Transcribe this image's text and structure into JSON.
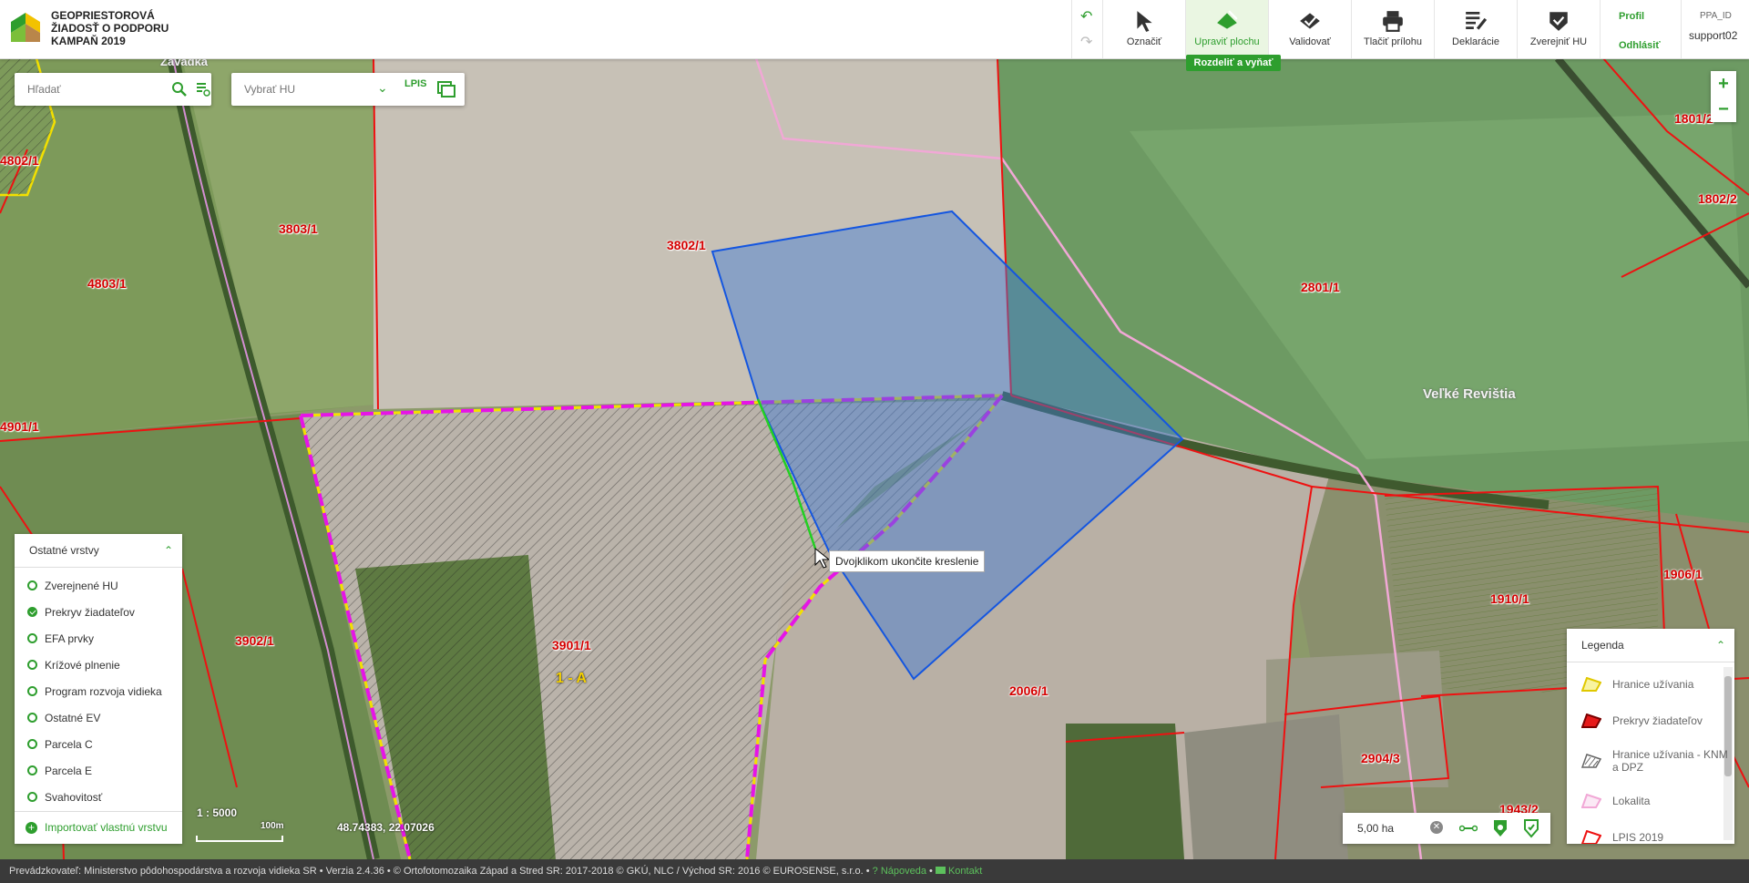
{
  "app": {
    "title_lines": [
      "GEOPRIESTOROVÁ",
      "ŽIADOSŤ O PODPORU",
      "KAMPAŇ 2019"
    ]
  },
  "toolbar": {
    "tools": [
      {
        "label": "Označiť",
        "icon": "cursor-icon"
      },
      {
        "label": "Upraviť plochu",
        "icon": "edit-area-icon",
        "active": true
      },
      {
        "label": "Validovať",
        "icon": "validate-icon"
      },
      {
        "label": "Tlačiť prílohu",
        "icon": "print-icon"
      },
      {
        "label": "Deklarácie",
        "icon": "declarations-icon"
      },
      {
        "label": "Zverejniť HU",
        "icon": "publish-icon"
      }
    ],
    "active_subaction": "Rozdeliť a vyňať",
    "profile_label": "Profil",
    "logout_label": "Odhlásiť",
    "ppa_label": "PPA_ID",
    "user": "support02"
  },
  "search": {
    "placeholder": "Hľadať",
    "hu_placeholder": "Vybrať HU",
    "lpis_label": "LPIS"
  },
  "layers_panel": {
    "title": "Ostatné vrstvy",
    "items": [
      {
        "label": "Zverejnené HU",
        "checked": false
      },
      {
        "label": "Prekryv žiadateľov",
        "checked": true
      },
      {
        "label": "EFA prvky",
        "checked": false
      },
      {
        "label": "Krížové plnenie",
        "checked": false
      },
      {
        "label": "Program rozvoja vidieka",
        "checked": false
      },
      {
        "label": "Ostatné EV",
        "checked": false
      },
      {
        "label": "Parcela C",
        "checked": false
      },
      {
        "label": "Parcela E",
        "checked": false
      },
      {
        "label": "Svahovitosť",
        "checked": false
      }
    ],
    "import_label": "Importovať vlastnú vrstvu"
  },
  "legend": {
    "title": "Legenda",
    "items": [
      "Hranice užívania",
      "Prekryv žiadateľov",
      "Hranice užívania - KNM a DPZ",
      "Lokalita",
      "LPIS 2019"
    ]
  },
  "map": {
    "tooltip": "Dvojklikom ukončite kreslenie",
    "scale": "1 : 5000",
    "scalebar": "100m",
    "coords": "48.74383, 22.07026",
    "area_value": "5,00 ha",
    "parcel_labels": [
      "4802/1",
      "3803/1",
      "4803/1",
      "3802/1",
      "2801/1",
      "1801/2",
      "1802/2",
      "4901/1",
      "3902/1",
      "3901/1",
      "2006/1",
      "1910/1",
      "1906/1",
      "2904/3",
      "1943/2"
    ],
    "place_names": [
      "Veľké Revištia",
      "Závadka"
    ],
    "block_label": "1 - A"
  },
  "footer": {
    "text": "Prevádzkovateľ: Ministerstvo pôdohospodárstva a rozvoja vidieka SR • Verzia 2.4.36 • © Ortofotomozaika Západ a Stred SR: 2017-2018 © GKÚ, NLC / Východ SR: 2016 © EUROSENSE, s.r.o. •",
    "help": "Nápoveda",
    "contact": "Kontakt"
  }
}
